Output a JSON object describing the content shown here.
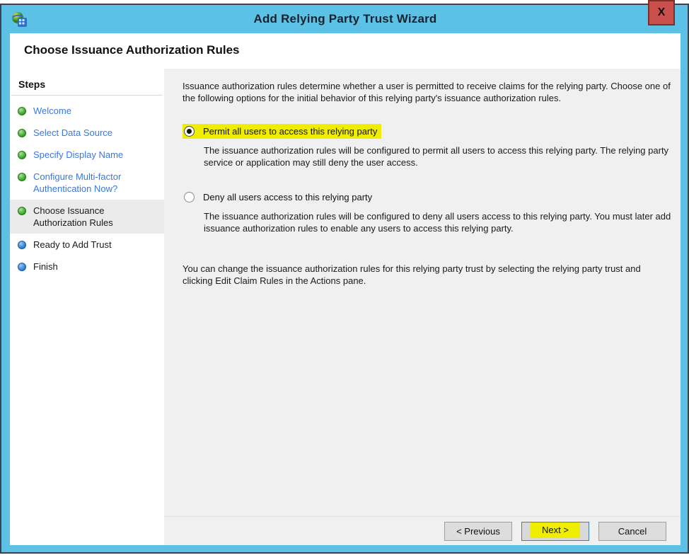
{
  "window": {
    "title": "Add Relying Party Trust Wizard",
    "close_label": "X",
    "heading": "Choose Issuance Authorization Rules"
  },
  "colors": {
    "titlebar_blue": "#5cc1e5",
    "frame_outline": "#3a4354",
    "close_button_red": "#c9504c",
    "highlight_yellow": "#f0ee00",
    "step_link_blue": "#3a78de",
    "step_done_green": "#3da32c",
    "step_todo_blue": "#2e7ed4",
    "content_gray": "#f0f0f0",
    "next_button_border": "#3c7fb1"
  },
  "sidebar": {
    "header": "Steps",
    "items": [
      {
        "label": "Welcome",
        "state": "done"
      },
      {
        "label": "Select Data Source",
        "state": "done"
      },
      {
        "label": "Specify Display Name",
        "state": "done"
      },
      {
        "label": "Configure Multi-factor Authentication Now?",
        "state": "done"
      },
      {
        "label": "Choose Issuance Authorization Rules",
        "state": "current"
      },
      {
        "label": "Ready to Add Trust",
        "state": "todo"
      },
      {
        "label": "Finish",
        "state": "todo"
      }
    ]
  },
  "content": {
    "intro": "Issuance authorization rules determine whether a user is permitted to receive claims for the relying party. Choose one of the following options for the initial behavior of this relying party's issuance authorization rules.",
    "options": [
      {
        "label": "Permit all users to access this relying party",
        "selected": true,
        "highlighted": true,
        "description": "The issuance authorization rules will be configured to permit all users to access this relying party. The relying party service or application may still deny the user access."
      },
      {
        "label": "Deny all users access to this relying party",
        "selected": false,
        "highlighted": false,
        "description": "The issuance authorization rules will be configured to deny all users access to this relying party. You must later add issuance authorization rules to enable any users to access this relying party."
      }
    ],
    "note": "You can change the issuance authorization rules for this relying party trust by selecting the relying party trust and clicking Edit Claim Rules in the Actions pane."
  },
  "footer": {
    "previous_label": "< Previous",
    "next_label": "Next >",
    "cancel_label": "Cancel"
  }
}
